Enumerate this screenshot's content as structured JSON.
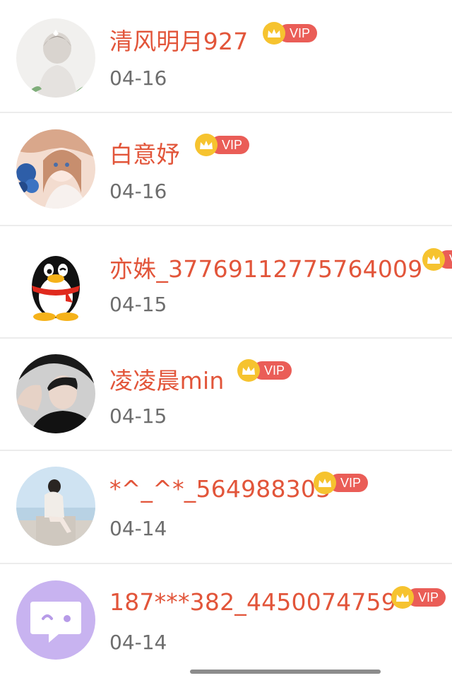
{
  "list": {
    "items": [
      {
        "name": "清风明月927",
        "date": "04-16",
        "badge": "VIP",
        "avatar": "girl-flower-illustration"
      },
      {
        "name": "白意妤",
        "date": "04-16",
        "badge": "VIP",
        "avatar": "anime-girl-illustration"
      },
      {
        "name": "亦姝_37769112775764009",
        "date": "04-15",
        "badge": "VIP",
        "avatar": "qq-penguin"
      },
      {
        "name": "凌凌晨min",
        "date": "04-15",
        "badge": "VIP",
        "avatar": "man-hat-portrait"
      },
      {
        "name": "*^_^*_564988303",
        "date": "04-14",
        "badge": "VIP",
        "avatar": "girl-seaside-photo"
      },
      {
        "name": "187***382_4450074759",
        "date": "04-14",
        "badge": "VIP",
        "avatar": "chat-bubble-default"
      }
    ]
  },
  "colors": {
    "name": "#e2553a",
    "date": "#6d6d6d",
    "vip_pill": "#ea5d57",
    "crown": "#f6c32f",
    "divider": "#ececec"
  }
}
